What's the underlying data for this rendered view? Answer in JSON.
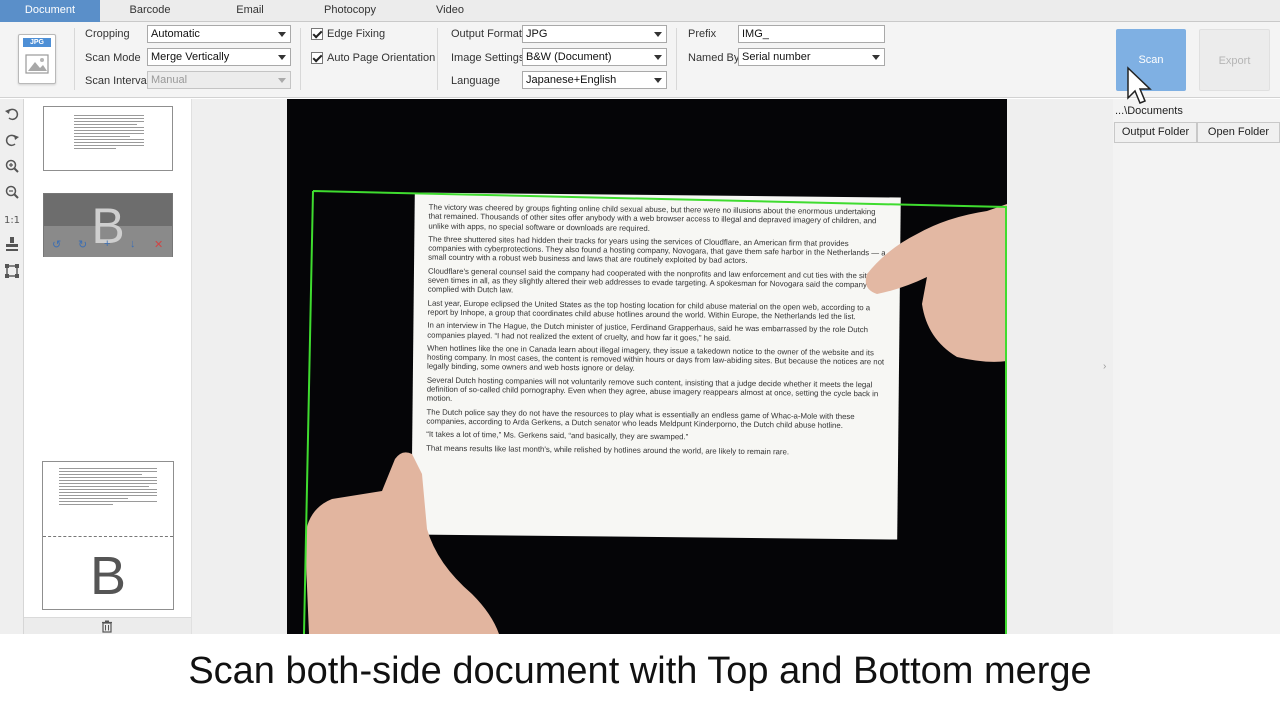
{
  "tabs": [
    {
      "label": "Document",
      "active": true
    },
    {
      "label": "Barcode",
      "active": false
    },
    {
      "label": "Email",
      "active": false
    },
    {
      "label": "Photocopy",
      "active": false
    },
    {
      "label": "Video",
      "active": false
    }
  ],
  "toolbar": {
    "file_icon_label": "JPG",
    "cropping": {
      "label": "Cropping",
      "value": "Automatic"
    },
    "scan_mode": {
      "label": "Scan Mode",
      "value": "Merge Vertically"
    },
    "scan_interval": {
      "label": "Scan Interval",
      "value": "Manual"
    },
    "edge_fixing": {
      "label": "Edge Fixing",
      "checked": true
    },
    "auto_page_orientation": {
      "label": "Auto Page Orientation",
      "checked": true
    },
    "output_format": {
      "label": "Output Format",
      "value": "JPG"
    },
    "image_settings": {
      "label": "Image Settings",
      "value": "B&W (Document)"
    },
    "language": {
      "label": "Language",
      "value": "Japanese+English"
    },
    "prefix": {
      "label": "Prefix",
      "value": "IMG_"
    },
    "named_by": {
      "label": "Named By",
      "value": "Serial number"
    },
    "scan_button": "Scan",
    "export_button": "Export"
  },
  "thumbnails": {
    "second_letter": "B",
    "merged_letter": "B"
  },
  "right_panel": {
    "path": "...\\Documents",
    "output_folder_button": "Output Folder",
    "open_folder_button": "Open Folder"
  },
  "document_text": [
    "The victory was cheered by groups fighting online child sexual abuse, but there were no illusions about the enormous undertaking that remained. Thousands of other sites offer anybody with a web browser access to illegal and depraved imagery of children, and unlike with apps, no special software or downloads are required.",
    "The three shuttered sites had hidden their tracks for years using the services of Cloudflare, an American firm that provides companies with cyberprotections. They also found a hosting company, Novogara, that gave them safe harbor in the Netherlands — a small country with a robust web business and laws that are routinely exploited by bad actors.",
    "Cloudflare's general counsel said the company had cooperated with the nonprofits and law enforcement and cut ties with the sites seven times in all, as they slightly altered their web addresses to evade targeting. A spokesman for Novogara said the company had complied with Dutch law.",
    "Last year, Europe eclipsed the United States as the top hosting location for child abuse material on the open web, according to a report by Inhope, a group that coordinates child abuse hotlines around the world. Within Europe, the Netherlands led the list.",
    "In an interview in The Hague, the Dutch minister of justice, Ferdinand Grapperhaus, said he was embarrassed by the role Dutch companies played. “I had not realized the extent of cruelty, and how far it goes,” he said.",
    "When hotlines like the one in Canada learn about illegal imagery, they issue a takedown notice to the owner of the website and its hosting company. In most cases, the content is removed within hours or days from law-abiding sites. But because the notices are not legally binding, some owners and web hosts ignore or delay.",
    "Several Dutch hosting companies will not voluntarily remove such content, insisting that a judge decide whether it meets the legal definition of so-called child pornography. Even when they agree, abuse imagery reappears almost at once, setting the cycle back in motion.",
    "The Dutch police say they do not have the resources to play what is essentially an endless game of Whac-a-Mole with these companies, according to Arda Gerkens, a Dutch senator who leads Meldpunt Kinderporno, the Dutch child abuse hotline.",
    "“It takes a lot of time,” Ms. Gerkens said, “and basically, they are swamped.”",
    "That means results like last month's, while relished by hotlines around the world, are likely to remain rare."
  ],
  "caption": "Scan both-side document with Top and Bottom merge",
  "colors": {
    "accent": "#5a8fc9",
    "crop_outline": "#3fdc2f"
  }
}
